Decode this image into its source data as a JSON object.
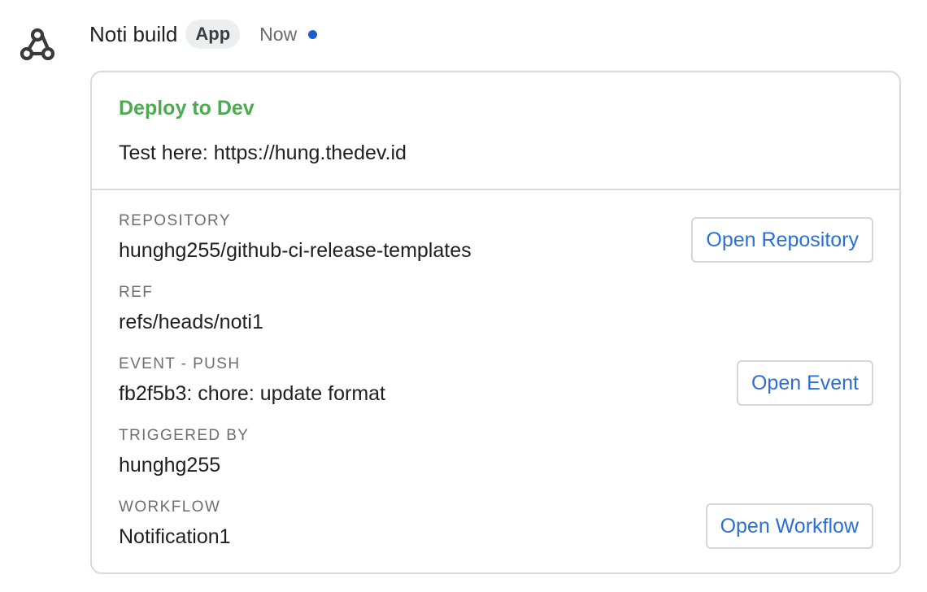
{
  "message": {
    "sender": "Noti build",
    "badge": "App",
    "timestamp": "Now",
    "avatar_icon": "webhook-icon",
    "unread_color": "#1a5fd0"
  },
  "card": {
    "title": "Deploy to Dev",
    "title_color": "#4caa4f",
    "text": "Test here: https://hung.thedev.id",
    "fields": [
      {
        "label": "REPOSITORY",
        "value": "hunghg255/github-ci-release-templates"
      },
      {
        "label": "REF",
        "value": "refs/heads/noti1"
      },
      {
        "label": "EVENT - PUSH",
        "value": "fb2f5b3: chore: update format"
      },
      {
        "label": "TRIGGERED BY",
        "value": "hunghg255"
      },
      {
        "label": "WORKFLOW",
        "value": "Notification1"
      }
    ],
    "buttons": {
      "repository": "Open Repository",
      "event": "Open Event",
      "workflow": "Open Workflow"
    },
    "button_color": "#2b6fd6"
  }
}
